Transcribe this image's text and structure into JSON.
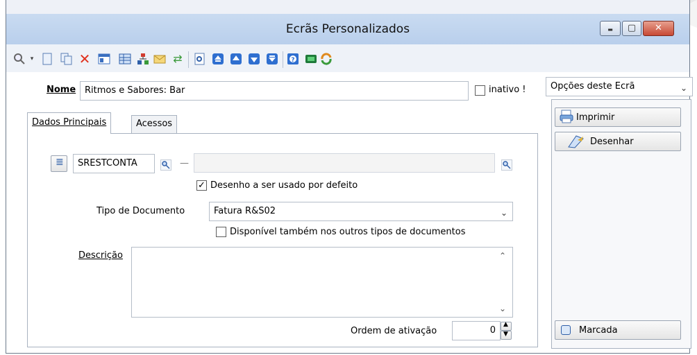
{
  "window": {
    "title": "Ecrãs Personalizados"
  },
  "window_controls": {
    "minimize": "▬",
    "maximize": "▢",
    "close": "✕"
  },
  "toolbar": {
    "icons": [
      "search-icon",
      "new-document-icon",
      "copy-icon",
      "delete-icon",
      "properties-icon",
      "table-icon",
      "structure-icon",
      "email-icon",
      "refresh-icon",
      "preview-icon",
      "first-record-icon",
      "previous-record-icon",
      "next-record-icon",
      "last-record-icon",
      "help-icon",
      "online-icon",
      "sync-icon"
    ]
  },
  "form": {
    "nome_label": "Nome",
    "nome_value": "Ritmos e Sabores: Bar",
    "inativo_label": "inativo !",
    "tabs": [
      {
        "label": "Dados Principais",
        "active": true
      },
      {
        "label": "Acessos",
        "active": false
      }
    ],
    "code_value": "SRESTCONTA",
    "code_separator": "—",
    "code_description": "",
    "default_design_label": "Desenho a ser usado por defeito",
    "default_design_checked": true,
    "tipo_documento_label": "Tipo de Documento",
    "tipo_documento_value": "Fatura R&S02",
    "disponivel_label": "Disponível também nos outros tipos de documentos",
    "disponivel_checked": false,
    "descricao_label": "Descrição",
    "descricao_value": "",
    "ordem_label": "Ordem de ativação",
    "ordem_value": "0"
  },
  "options": {
    "dropdown_label": "Opções deste Ecrã",
    "imprimir_label": "Imprimir",
    "desenhar_label": "Desenhar",
    "marcada_label": "Marcada"
  },
  "colors": {
    "title_gradient_top": "#c9dbf1",
    "close_button": "#c74934",
    "delete_icon": "#e0321e"
  }
}
